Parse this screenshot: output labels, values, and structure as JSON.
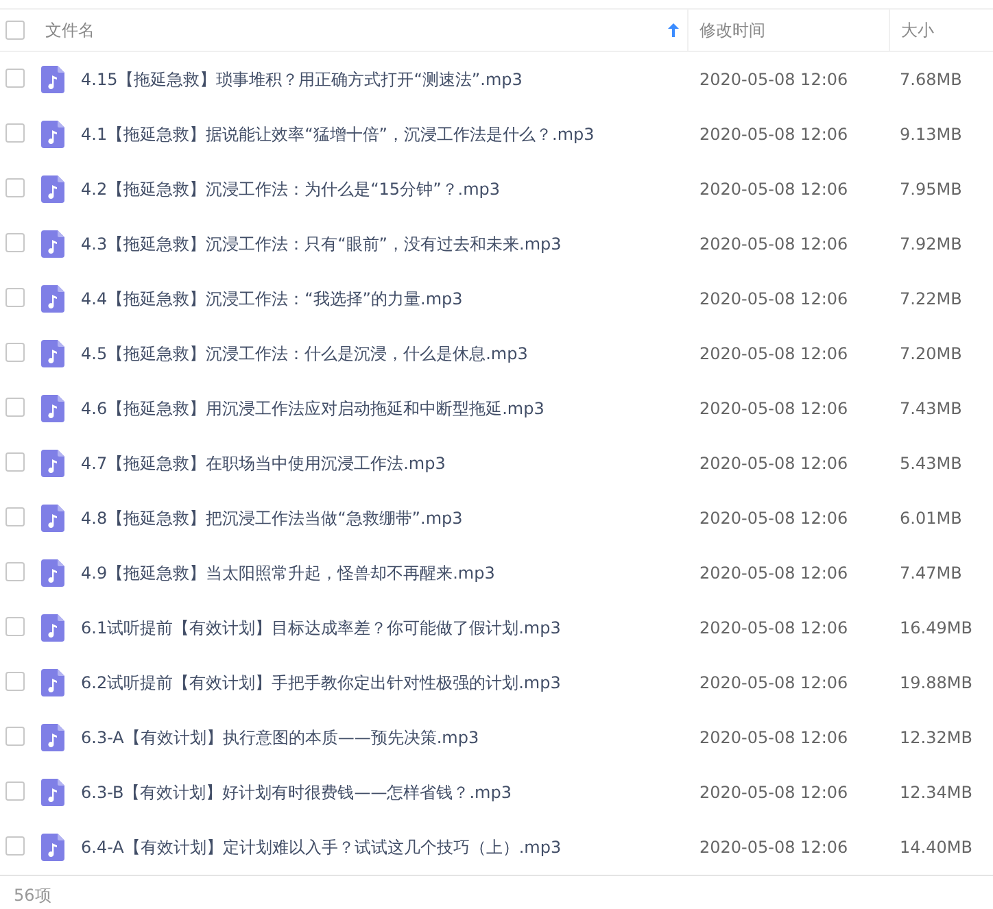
{
  "header": {
    "select_all": {
      "checked": false
    },
    "columns": [
      {
        "label": "文件名",
        "sorted": true
      },
      {
        "label": "修改时间",
        "sorted": false
      },
      {
        "label": "大小",
        "sorted": false
      }
    ]
  },
  "rows": [
    {
      "name": "4.15【拖延急救】琐事堆积？用正确方式打开“测速法”.mp3",
      "modified": "2020-05-08 12:06",
      "size": "7.68MB",
      "checked": false
    },
    {
      "name": "4.1【拖延急救】据说能让效率“猛增十倍”，沉浸工作法是什么？.mp3",
      "modified": "2020-05-08 12:06",
      "size": "9.13MB",
      "checked": false
    },
    {
      "name": "4.2【拖延急救】沉浸工作法：为什么是“15分钟”？.mp3",
      "modified": "2020-05-08 12:06",
      "size": "7.95MB",
      "checked": false
    },
    {
      "name": "4.3【拖延急救】沉浸工作法：只有“眼前”，没有过去和未来.mp3",
      "modified": "2020-05-08 12:06",
      "size": "7.92MB",
      "checked": false
    },
    {
      "name": "4.4【拖延急救】沉浸工作法：“我选择”的力量.mp3",
      "modified": "2020-05-08 12:06",
      "size": "7.22MB",
      "checked": false
    },
    {
      "name": "4.5【拖延急救】沉浸工作法：什么是沉浸，什么是休息.mp3",
      "modified": "2020-05-08 12:06",
      "size": "7.20MB",
      "checked": false
    },
    {
      "name": "4.6【拖延急救】用沉浸工作法应对启动拖延和中断型拖延.mp3",
      "modified": "2020-05-08 12:06",
      "size": "7.43MB",
      "checked": false
    },
    {
      "name": "4.7【拖延急救】在职场当中使用沉浸工作法.mp3",
      "modified": "2020-05-08 12:06",
      "size": "5.43MB",
      "checked": false
    },
    {
      "name": "4.8【拖延急救】把沉浸工作法当做“急救绷带”.mp3",
      "modified": "2020-05-08 12:06",
      "size": "6.01MB",
      "checked": false
    },
    {
      "name": "4.9【拖延急救】当太阳照常升起，怪兽却不再醒来.mp3",
      "modified": "2020-05-08 12:06",
      "size": "7.47MB",
      "checked": false
    },
    {
      "name": "6.1试听提前【有效计划】目标达成率差？你可能做了假计划.mp3",
      "modified": "2020-05-08 12:06",
      "size": "16.49MB",
      "checked": false
    },
    {
      "name": "6.2试听提前【有效计划】手把手教你定出针对性极强的计划.mp3",
      "modified": "2020-05-08 12:06",
      "size": "19.88MB",
      "checked": false
    },
    {
      "name": "6.3-A【有效计划】执行意图的本质——预先决策.mp3",
      "modified": "2020-05-08 12:06",
      "size": "12.32MB",
      "checked": false
    },
    {
      "name": "6.3-B【有效计划】好计划有时很费钱——怎样省钱？.mp3",
      "modified": "2020-05-08 12:06",
      "size": "12.34MB",
      "checked": false
    },
    {
      "name": "6.4-A【有效计划】定计划难以入手？试试这几个技巧（上）.mp3",
      "modified": "2020-05-08 12:06",
      "size": "14.40MB",
      "checked": false
    }
  ],
  "footer": {
    "count": "56项"
  }
}
